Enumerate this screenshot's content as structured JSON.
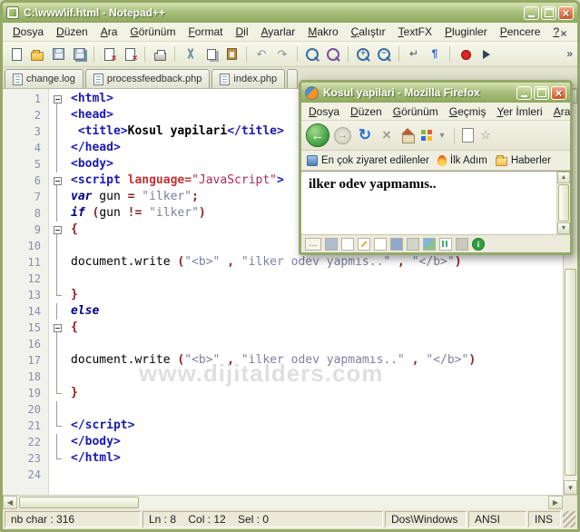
{
  "watermark": "www.dijitalders.com",
  "notepad": {
    "title": "C:\\www\\if.html - Notepad++",
    "menus": [
      "Dosya",
      "Düzen",
      "Ara",
      "Görünüm",
      "Format",
      "Dil",
      "Ayarlar",
      "Makro",
      "Çalıştır",
      "TextFX",
      "Pluginler",
      "Pencere",
      "?"
    ],
    "toolbar_icons": [
      "new-file",
      "open",
      "save",
      "save-all",
      "sep",
      "close-doc",
      "close-all",
      "sep",
      "print",
      "sep",
      "cut",
      "copy",
      "paste",
      "sep",
      "undo",
      "redo",
      "sep",
      "find",
      "replace",
      "sep",
      "zoom-in",
      "zoom-out",
      "sep",
      "word-wrap",
      "show-all-chars",
      "sep",
      "record-macro",
      "play-macro"
    ],
    "toolbar_overflow": "»",
    "menubar_close": "×",
    "tabs": [
      {
        "label": "change.log"
      },
      {
        "label": "processfeedback.php"
      },
      {
        "label": "index.php"
      }
    ],
    "editor": {
      "lines": [
        {
          "n": 1,
          "f": "box",
          "s": [
            [
              "<html>",
              "tag"
            ]
          ]
        },
        {
          "n": 2,
          "f": "v",
          "s": [
            [
              "<head>",
              "tag"
            ]
          ]
        },
        {
          "n": 3,
          "f": "v",
          "s": [
            [
              " <title>",
              "tag"
            ],
            [
              "Kosul yapilari",
              "b"
            ],
            [
              "</title>",
              "tag"
            ]
          ]
        },
        {
          "n": 4,
          "f": "v",
          "s": [
            [
              "</head>",
              "tag"
            ]
          ]
        },
        {
          "n": 5,
          "f": "v",
          "s": [
            [
              "<body>",
              "tag"
            ]
          ]
        },
        {
          "n": 6,
          "f": "box",
          "s": [
            [
              "<script ",
              "tag"
            ],
            [
              "language=",
              "attr"
            ],
            [
              "\"JavaScript\"",
              "attrval"
            ],
            [
              ">",
              "tag"
            ]
          ]
        },
        {
          "n": 7,
          "f": "v",
          "s": [
            [
              "var",
              "kw"
            ],
            [
              " gun ",
              "plain"
            ],
            [
              "= ",
              "op"
            ],
            [
              "\"ilker\"",
              "str"
            ],
            [
              ";",
              "op"
            ]
          ]
        },
        {
          "n": 8,
          "f": "v",
          "s": [
            [
              "if",
              "kw"
            ],
            [
              " ",
              "plain"
            ],
            [
              "(",
              "op"
            ],
            [
              "gun ",
              "plain"
            ],
            [
              "!= ",
              "op"
            ],
            [
              "\"ilker\"",
              "str"
            ],
            [
              ")",
              "op"
            ]
          ]
        },
        {
          "n": 9,
          "f": "box",
          "s": [
            [
              "{",
              "op"
            ]
          ]
        },
        {
          "n": 10,
          "f": "v",
          "s": []
        },
        {
          "n": 11,
          "f": "v",
          "s": [
            [
              "document.write ",
              "plain"
            ],
            [
              "(",
              "op"
            ],
            [
              "\"<b>\"",
              "str"
            ],
            [
              " , ",
              "op"
            ],
            [
              "\"ilker odev yapmıs..\"",
              "str"
            ],
            [
              " , ",
              "op"
            ],
            [
              "\"</b>\"",
              "str"
            ],
            [
              ")",
              "op"
            ]
          ]
        },
        {
          "n": 12,
          "f": "v",
          "s": []
        },
        {
          "n": 13,
          "f": "end",
          "s": [
            [
              "}",
              "op"
            ]
          ]
        },
        {
          "n": 14,
          "f": "v",
          "s": [
            [
              "else",
              "kw"
            ]
          ]
        },
        {
          "n": 15,
          "f": "box",
          "s": [
            [
              "{",
              "op"
            ]
          ]
        },
        {
          "n": 16,
          "f": "v",
          "s": []
        },
        {
          "n": 17,
          "f": "v",
          "s": [
            [
              "document.write ",
              "plain"
            ],
            [
              "(",
              "op"
            ],
            [
              "\"<b>\"",
              "str"
            ],
            [
              " , ",
              "op"
            ],
            [
              "\"ilker odev yapmamıs..\"",
              "str"
            ],
            [
              " , ",
              "op"
            ],
            [
              "\"</b>\"",
              "str"
            ],
            [
              ")",
              "op"
            ]
          ]
        },
        {
          "n": 18,
          "f": "v",
          "s": []
        },
        {
          "n": 19,
          "f": "end",
          "s": [
            [
              "}",
              "op"
            ]
          ]
        },
        {
          "n": 20,
          "f": "v",
          "s": []
        },
        {
          "n": 21,
          "f": "end",
          "s": [
            [
              "</script>",
              "tag"
            ]
          ]
        },
        {
          "n": 22,
          "f": "v",
          "s": [
            [
              "</body>",
              "tag"
            ]
          ]
        },
        {
          "n": 23,
          "f": "end",
          "s": [
            [
              "</html>",
              "tag"
            ]
          ]
        },
        {
          "n": 24,
          "f": "",
          "s": []
        }
      ]
    },
    "status": {
      "chars": "nb char : 316",
      "position": "Ln : 8    Col : 12    Sel : 0",
      "format": "Dos\\Windows",
      "encoding": "ANSI",
      "mode": "INS"
    }
  },
  "firefox": {
    "title": "Kosul yapilari - Mozilla Firefox",
    "menus": [
      "Dosya",
      "Düzen",
      "Görünüm",
      "Geçmiş",
      "Yer İmleri",
      "Araçlar"
    ],
    "nav_icons": [
      "back",
      "forward",
      "refresh",
      "stop",
      "home",
      "grid",
      "caret",
      "sep",
      "page",
      "star"
    ],
    "bookmarks": [
      {
        "label": "En çok ziyaret edilenler",
        "icon": "mostvisited"
      },
      {
        "label": "İlk Adım",
        "icon": "flame"
      },
      {
        "label": "Haberler",
        "icon": "folder"
      }
    ],
    "content_text": "ilker odev yapmamıs..",
    "status_icons": [
      "dots",
      "extension",
      "doc",
      "edit",
      "doc2",
      "save",
      "print",
      "image",
      "stats",
      "tools",
      "info"
    ]
  }
}
